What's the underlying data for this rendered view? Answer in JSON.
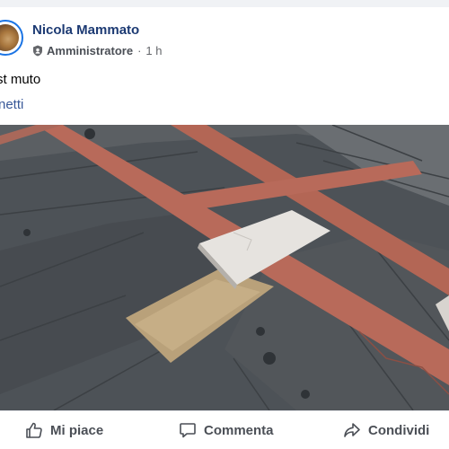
{
  "post": {
    "author": "Nicola Mammato",
    "role": "Amministratore",
    "separator": "·",
    "time": "1 h",
    "text": "st muto",
    "link_text": "netti"
  },
  "actions": {
    "like": "Mi piace",
    "comment": "Commenta",
    "share": "Condividi"
  },
  "colors": {
    "accent": "#1b74e4",
    "author": "#1c3a73",
    "link": "#385898"
  },
  "icons": {
    "shield": "admin-shield-icon",
    "like": "thumbs-up-icon",
    "comment": "speech-bubble-icon",
    "share": "share-arrow-icon"
  }
}
